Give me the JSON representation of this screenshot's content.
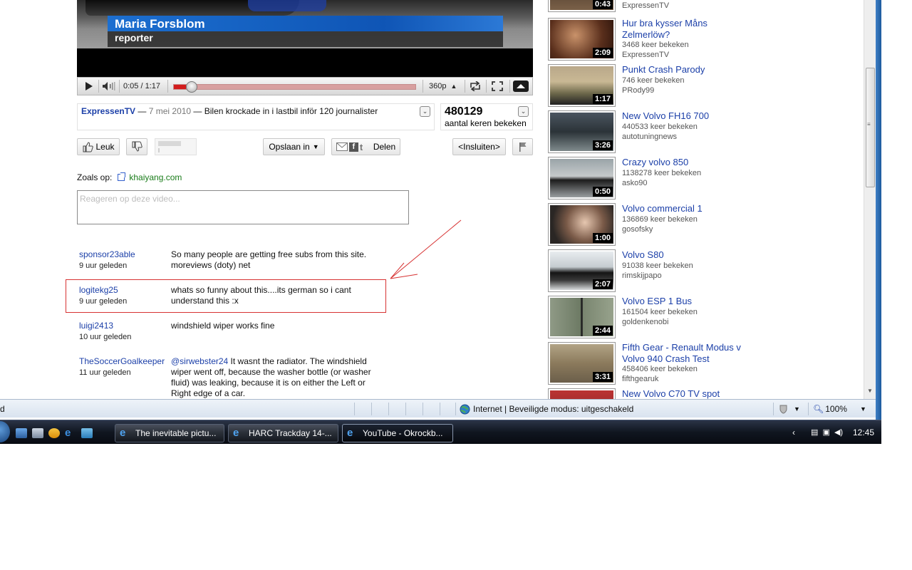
{
  "video": {
    "name_overlay": "Maria Forsblom",
    "role_overlay": "reporter",
    "time": "0:05 / 1:17",
    "progress": 0.05,
    "quality": "360p"
  },
  "info": {
    "channel": "ExpressenTV",
    "separator": " — ",
    "date": "7 mei 2010",
    "title": "Bilen krockade in i lastbil inför 120 journalister",
    "views": "480129",
    "views_label": "aantal keren bekeken"
  },
  "actions": {
    "like": "Leuk",
    "save": "Opslaan in",
    "share": "Delen",
    "embed": "<Insluiten>"
  },
  "seen_on": {
    "label": "Zoals op:",
    "link": "khaiyang.com"
  },
  "comment_box": {
    "placeholder": "Reageren op deze video..."
  },
  "comments": [
    {
      "user": "sponsor23able",
      "ago": "9 uur geleden",
      "text": "So many people are getting free subs from this site. moreviews (doty) net"
    },
    {
      "user": "logitekg25",
      "ago": "9 uur geleden",
      "text": "whats so funny about this....its german so i cant understand this :x"
    },
    {
      "user": "luigi2413",
      "ago": "10 uur geleden",
      "text": "windshield wiper works fine"
    },
    {
      "user": "TheSoccerGoalkeeper",
      "ago": "11 uur geleden",
      "mention": "@sirwebster24",
      "text": " It wasnt the radiator. The windshield wiper went off, because the washer bottle (or washer fluid) was leaking, because it is on either the Left or Right edge of a car."
    }
  ],
  "related": [
    {
      "title": "",
      "views": "",
      "channel": "ExpressenTV",
      "duration": "0:43"
    },
    {
      "title": "Hur bra kysser Måns Zelmerlöw?",
      "views": "3468 keer bekeken",
      "channel": "ExpressenTV",
      "duration": "2:09"
    },
    {
      "title": "Punkt Crash Parody",
      "views": "746 keer bekeken",
      "channel": "PRody99",
      "duration": "1:17"
    },
    {
      "title": "New Volvo FH16 700",
      "views": "440533 keer bekeken",
      "channel": "autotuningnews",
      "duration": "3:26"
    },
    {
      "title": "Crazy volvo 850",
      "views": "1138278 keer bekeken",
      "channel": "asko90",
      "duration": "0:50"
    },
    {
      "title": "Volvo commercial 1",
      "views": "136869 keer bekeken",
      "channel": "gosofsky",
      "duration": "1:00"
    },
    {
      "title": "Volvo S80",
      "views": "91038 keer bekeken",
      "channel": "rimskijpapo",
      "duration": "2:07"
    },
    {
      "title": "Volvo ESP 1 Bus",
      "views": "161504 keer bekeken",
      "channel": "goldenkenobi",
      "duration": "2:44"
    },
    {
      "title": "Fifth Gear - Renault Modus v Volvo 940 Crash Test",
      "views": "458406 keer bekeken",
      "channel": "fifthgearuk",
      "duration": "3:31"
    },
    {
      "title": "New Volvo C70 TV spot",
      "views": "",
      "channel": "",
      "duration": ""
    }
  ],
  "statusbar": {
    "left": "d",
    "zone": "Internet | Beveiligde modus: uitgeschakeld",
    "zoom": "100%"
  },
  "taskbar": {
    "windows": [
      "The inevitable pictu...",
      "HARC Trackday 14-...",
      "YouTube - Okrockb..."
    ],
    "clock": "12:45"
  },
  "colors": {
    "link": "#1b3fa8",
    "progress_fill": "#d21c1c",
    "annotation": "#d73232",
    "taskbar": "#101620"
  }
}
